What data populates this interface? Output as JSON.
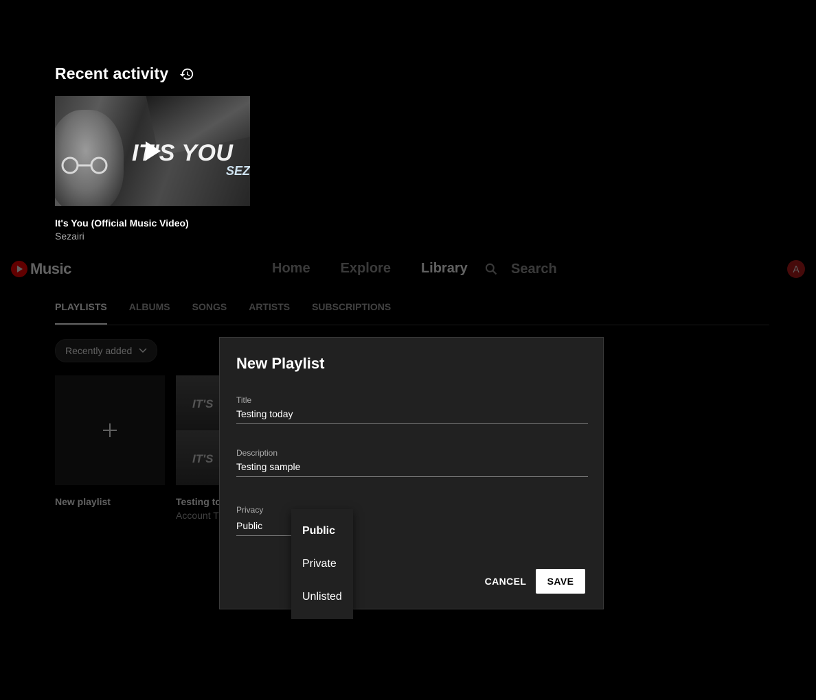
{
  "recent": {
    "title": "Recent activity",
    "history_icon": "history-icon",
    "item": {
      "thumbnail_text": "IT'S YOU",
      "thumbnail_subtext": "SEZ",
      "title": "It's You (Official Music Video)",
      "artist": "Sezairi"
    }
  },
  "header": {
    "logo_text": "Music",
    "nav": [
      "Home",
      "Explore",
      "Library"
    ],
    "search_placeholder": "Search",
    "avatar_initial": "A"
  },
  "tabs": [
    "PLAYLISTS",
    "ALBUMS",
    "SONGS",
    "ARTISTS",
    "SUBSCRIPTIONS"
  ],
  "sort": {
    "label": "Recently added"
  },
  "cards": {
    "new_label": "New playlist",
    "playlist_thumb_text": "IT'S",
    "playlist_title": "Testing to",
    "playlist_sub": "Account T"
  },
  "dialog": {
    "title": "New Playlist",
    "title_field": {
      "label": "Title",
      "value": "Testing today"
    },
    "description_field": {
      "label": "Description",
      "value": "Testing sample"
    },
    "privacy_field": {
      "label": "Privacy",
      "value": "Public"
    },
    "cancel": "CANCEL",
    "save": "SAVE"
  },
  "privacy_options": [
    "Public",
    "Private",
    "Unlisted"
  ],
  "privacy_selected": "Public",
  "colors": {
    "background": "#000000",
    "dialog": "#212121",
    "brand_red": "#ff0000",
    "avatar": "#b71c1c"
  }
}
